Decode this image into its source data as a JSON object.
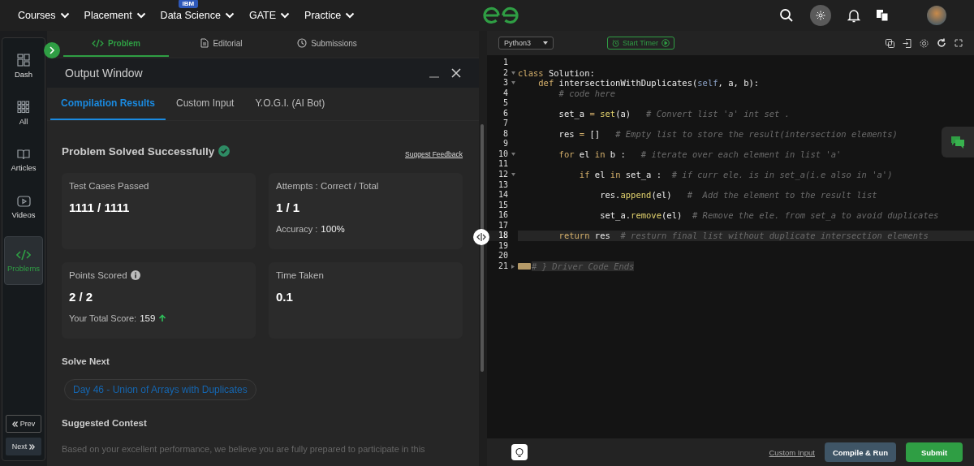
{
  "nav": {
    "items": [
      {
        "label": "Courses"
      },
      {
        "label": "Placement"
      },
      {
        "label": "Data Science",
        "badge": "IBM"
      },
      {
        "label": "GATE"
      },
      {
        "label": "Practice"
      }
    ]
  },
  "sidebar": {
    "items": [
      {
        "label": "Dash",
        "selected": false
      },
      {
        "label": "All",
        "selected": false
      },
      {
        "label": "Articles",
        "selected": false
      },
      {
        "label": "Videos",
        "selected": false
      },
      {
        "label": "Problems",
        "selected": true
      }
    ],
    "prev": "Prev",
    "next": "Next"
  },
  "problem_tabs": [
    {
      "label": "Problem",
      "selected": true
    },
    {
      "label": "Editorial",
      "selected": false
    },
    {
      "label": "Submissions",
      "selected": false
    }
  ],
  "output_window": {
    "title": "Output Window",
    "tabs": [
      {
        "label": "Compilation Results",
        "selected": true
      },
      {
        "label": "Custom Input",
        "selected": false
      },
      {
        "label": "Y.O.G.I. (AI Bot)",
        "selected": false
      }
    ],
    "heading": "Problem Solved Successfully",
    "feedback_link": "Suggest Feedback",
    "cards": [
      {
        "label": "Test Cases Passed",
        "value": "1111 / 1111",
        "info": false
      },
      {
        "label": "Attempts : Correct / Total",
        "value": "1 / 1",
        "info": false,
        "note_label": "Accuracy :",
        "note_value": "100%",
        "trend": false
      },
      {
        "label": "Points Scored",
        "value": "2 / 2",
        "info": true,
        "note_label": "Your Total Score:",
        "note_value": "159",
        "trend": true
      },
      {
        "label": "Time Taken",
        "value": "0.1",
        "info": false
      }
    ],
    "solve_next": "Solve Next",
    "next_problem": "Day 46 - Union of Arrays with Duplicates",
    "suggested_contest": "Suggested Contest",
    "contest_text": "Based on your excellent performance, we believe you are fully prepared to participate in this"
  },
  "editor": {
    "language": "Python3",
    "timer": "Start Timer",
    "lines": [
      {
        "n": "1"
      },
      {
        "n": "2",
        "foldable": true,
        "collapsed": false,
        "tokens": [
          {
            "kind": "keyword",
            "text": "class"
          },
          {
            "kind": "plain",
            "text": " Solution:"
          }
        ]
      },
      {
        "n": "3",
        "foldable": true,
        "collapsed": false,
        "tokens": [
          {
            "kind": "keyword",
            "text": "    def"
          },
          {
            "kind": "plain",
            "text": " intersectionWithDuplicates("
          },
          {
            "kind": "self",
            "text": "self"
          },
          {
            "kind": "plain",
            "text": ", a, b):"
          }
        ]
      },
      {
        "n": "4",
        "tokens": [
          {
            "kind": "comment",
            "text": "        # code here"
          }
        ]
      },
      {
        "n": "5"
      },
      {
        "n": "6",
        "tokens": [
          {
            "kind": "plain",
            "text": "        set_a "
          },
          {
            "kind": "keyword",
            "text": "="
          },
          {
            "kind": "builtin",
            "text": " set"
          },
          {
            "kind": "plain",
            "text": "(a)   "
          },
          {
            "kind": "comment",
            "text": "# Convert list 'a' int set ."
          }
        ]
      },
      {
        "n": "7"
      },
      {
        "n": "8",
        "tokens": [
          {
            "kind": "plain",
            "text": "        res "
          },
          {
            "kind": "keyword",
            "text": "="
          },
          {
            "kind": "plain",
            "text": " []   "
          },
          {
            "kind": "comment",
            "text": "# Empty list to store the result(intersection elements)"
          }
        ]
      },
      {
        "n": "9"
      },
      {
        "n": "10",
        "foldable": true,
        "collapsed": false,
        "tokens": [
          {
            "kind": "keyword",
            "text": "        for"
          },
          {
            "kind": "plain",
            "text": " el "
          },
          {
            "kind": "keyword",
            "text": "in"
          },
          {
            "kind": "plain",
            "text": " b :   "
          },
          {
            "kind": "comment",
            "text": "# iterate over each element in list 'a'"
          }
        ]
      },
      {
        "n": "11"
      },
      {
        "n": "12",
        "foldable": true,
        "collapsed": false,
        "tokens": [
          {
            "kind": "keyword",
            "text": "            if"
          },
          {
            "kind": "plain",
            "text": " el "
          },
          {
            "kind": "keyword",
            "text": "in"
          },
          {
            "kind": "plain",
            "text": " set_a :  "
          },
          {
            "kind": "comment",
            "text": "# if curr ele. is in set_a(i.e also in 'a')"
          }
        ]
      },
      {
        "n": "13"
      },
      {
        "n": "14",
        "tokens": [
          {
            "kind": "plain",
            "text": "                res."
          },
          {
            "kind": "builtin",
            "text": "append"
          },
          {
            "kind": "plain",
            "text": "(el)   "
          },
          {
            "kind": "comment",
            "text": "#  Add the element to the result list"
          }
        ]
      },
      {
        "n": "15"
      },
      {
        "n": "16",
        "tokens": [
          {
            "kind": "plain",
            "text": "                set_a."
          },
          {
            "kind": "builtin",
            "text": "remove"
          },
          {
            "kind": "plain",
            "text": "(el)  "
          },
          {
            "kind": "comment",
            "text": "# Remove the ele. from set_a to avoid duplicates"
          }
        ]
      },
      {
        "n": "17"
      },
      {
        "n": "18",
        "active": true,
        "tokens": [
          {
            "kind": "keyword",
            "text": "        return"
          },
          {
            "kind": "plain",
            "text": " res  "
          },
          {
            "kind": "comment",
            "text": "# resturn final list without duplicate intersection elements"
          }
        ]
      },
      {
        "n": "19"
      },
      {
        "n": "20"
      },
      {
        "n": "21",
        "foldable": true,
        "collapsed": true,
        "tokens": [
          {
            "kind": "folded",
            "text": "# } Driver Code Ends"
          }
        ]
      }
    ]
  },
  "footer": {
    "custom_input": "Custom Input",
    "compile": "Compile & Run",
    "submit": "Submit"
  }
}
